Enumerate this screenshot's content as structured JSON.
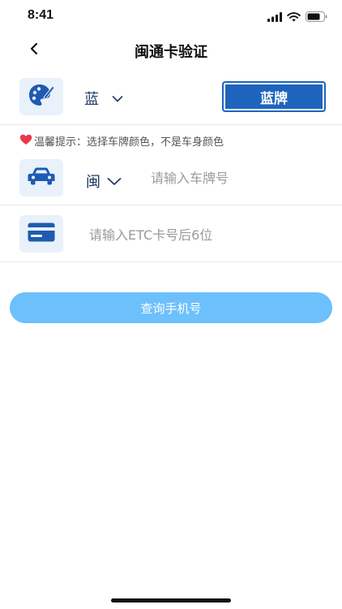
{
  "status_bar": {
    "time": "8:41"
  },
  "nav": {
    "title": "闽通卡验证",
    "back_icon": "chevron-left-icon"
  },
  "plate_color": {
    "icon": "palette-icon",
    "value": "蓝",
    "badge_label": "蓝牌",
    "badge_color": "#1e64bd"
  },
  "tip": {
    "icon": "heart-icon",
    "text": "温馨提示：选择车牌颜色，不是车身颜色"
  },
  "plate_number": {
    "icon": "car-icon",
    "province": "闽",
    "placeholder": "请输入车牌号",
    "value": ""
  },
  "etc_card": {
    "icon": "card-icon",
    "placeholder": "请输入ETC卡号后6位",
    "value": ""
  },
  "actions": {
    "query_label": "查询手机号",
    "query_color": "#6cc0fb"
  }
}
